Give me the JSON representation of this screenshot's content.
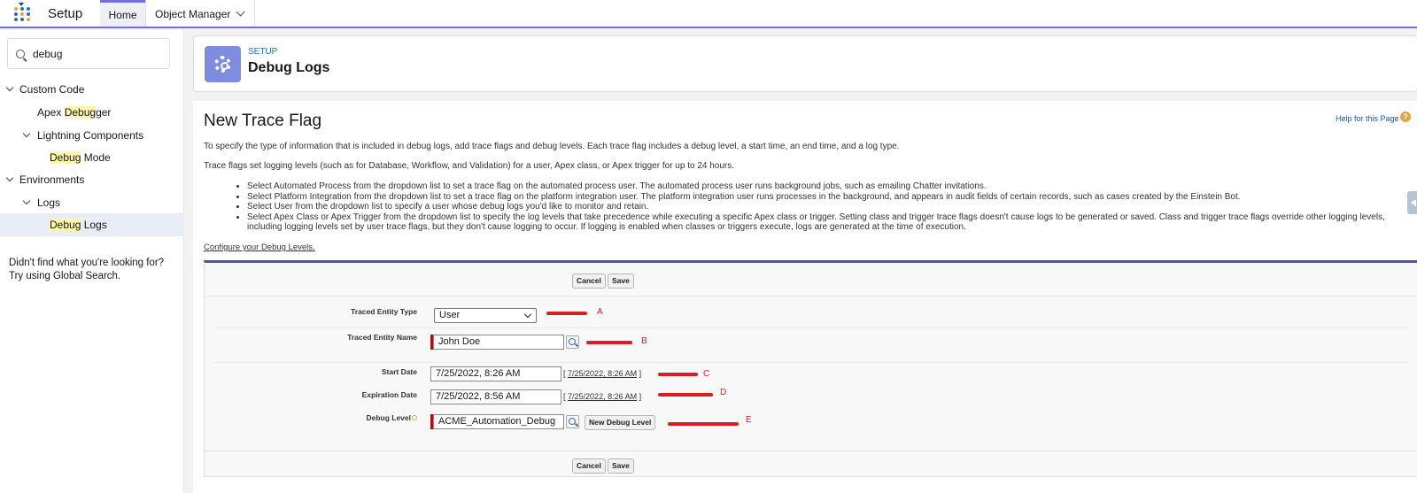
{
  "topbar": {
    "app_name": "Setup",
    "tabs": [
      {
        "label": "Home",
        "active": true
      },
      {
        "label": "Object Manager"
      }
    ],
    "accent_color": "#6f6fe0"
  },
  "sidebar": {
    "search_value": "debug",
    "items": [
      {
        "label": "Custom Code"
      },
      {
        "pre": "Apex ",
        "hl": "Debug",
        "post": "ger"
      },
      {
        "label": "Lightning Components"
      },
      {
        "hl": "Debug",
        "post": " Mode"
      },
      {
        "label": "Environments"
      },
      {
        "label": "Logs"
      },
      {
        "hl": "Debug",
        "post": " Logs",
        "selected": true
      }
    ],
    "footer_line1": "Didn't find what you're looking for?",
    "footer_line2": "Try using Global Search."
  },
  "header": {
    "eyebrow": "SETUP",
    "title": "Debug Logs",
    "icon": "gear-icon"
  },
  "main": {
    "title": "New Trace Flag",
    "help_link": "Help for this Page",
    "para1": "To specify the type of information that is included in debug logs, add trace flags and debug levels. Each trace flag includes a debug level, a start time, an end time, and a log type.",
    "para2": "Trace flags set logging levels (such as for Database, Workflow, and Validation) for a user, Apex class, or Apex trigger for up to 24 hours.",
    "bullets": [
      "Select Automated Process from the dropdown list to set a trace flag on the automated process user. The automated process user runs background jobs, such as emailing Chatter invitations.",
      "Select Platform Integration from the dropdown list to set a trace flag on the platform integration user. The platform integration user runs processes in the background, and appears in audit fields of certain records, such as cases created by the Einstein Bot.",
      "Select User from the dropdown list to specify a user whose debug logs you'd like to monitor and retain.",
      "Select Apex Class or Apex Trigger from the dropdown list to specify the log levels that take precedence while executing a specific Apex class or trigger. Setting class and trigger trace flags doesn't cause logs to be generated or saved. Class and trigger trace flags override other logging levels, including logging levels set by user trace flags, but they don't cause logging to occur. If logging is enabled when classes or triggers execute, logs are generated at the time of execution."
    ],
    "configure_link": "Configure your Debug Levels."
  },
  "form": {
    "cancel_label": "Cancel",
    "save_label": "Save",
    "traced_entity_type_label": "Traced Entity Type",
    "traced_entity_type_value": "User",
    "traced_entity_name_label": "Traced Entity Name",
    "traced_entity_name_value": "John Doe",
    "start_date_label": "Start Date",
    "start_date_value": "7/25/2022, 8:26 AM",
    "start_date_link": "7/25/2022, 8:26 AM",
    "expiration_date_label": "Expiration Date",
    "expiration_date_value": "7/25/2022, 8:56 AM",
    "expiration_date_link": "7/25/2022, 8:26 AM",
    "debug_level_label": "Debug Level",
    "debug_level_value": "ACME_Automation_Debug",
    "new_debug_level_label": "New Debug Level",
    "bracket_open": "[",
    "bracket_close": "]"
  },
  "annotations": {
    "color": "#d91f1f",
    "letters": [
      "A",
      "B",
      "C",
      "D",
      "E"
    ]
  }
}
